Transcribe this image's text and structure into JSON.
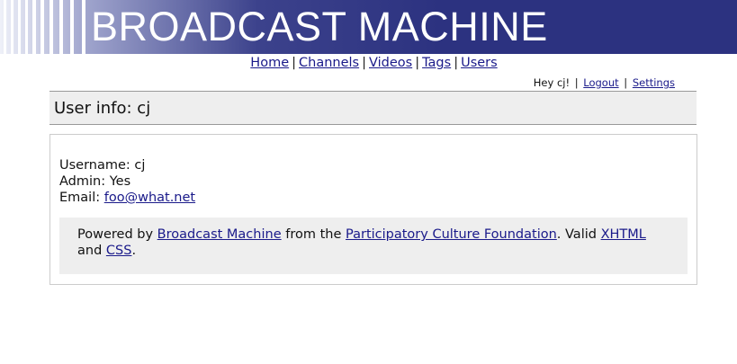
{
  "header": {
    "site_name": "BROADCAST MACHINE",
    "background_color": "#2c3280"
  },
  "nav": {
    "items": [
      {
        "label": "Home"
      },
      {
        "label": "Channels"
      },
      {
        "label": "Videos"
      },
      {
        "label": "Tags"
      },
      {
        "label": "Users"
      }
    ],
    "separator": "|"
  },
  "userbar": {
    "greeting": "Hey cj!",
    "logout_label": "Logout",
    "settings_label": "Settings",
    "separator": "|"
  },
  "page": {
    "title": "User info: cj"
  },
  "user": {
    "username_label": "Username:",
    "username": "cj",
    "admin_label": "Admin:",
    "admin": "Yes",
    "email_label": "Email:",
    "email": "foo@what.net"
  },
  "footer": {
    "powered_by": "Powered by",
    "bm_link": "Broadcast Machine",
    "from_the": "from the",
    "pcf_link": "Participatory Culture Foundation",
    "valid": ". Valid",
    "xhtml_link": "XHTML",
    "and": "and",
    "css_link": "CSS",
    "period": "."
  },
  "colors": {
    "link": "#1a1a8a",
    "panel_background": "#eeeeee"
  }
}
